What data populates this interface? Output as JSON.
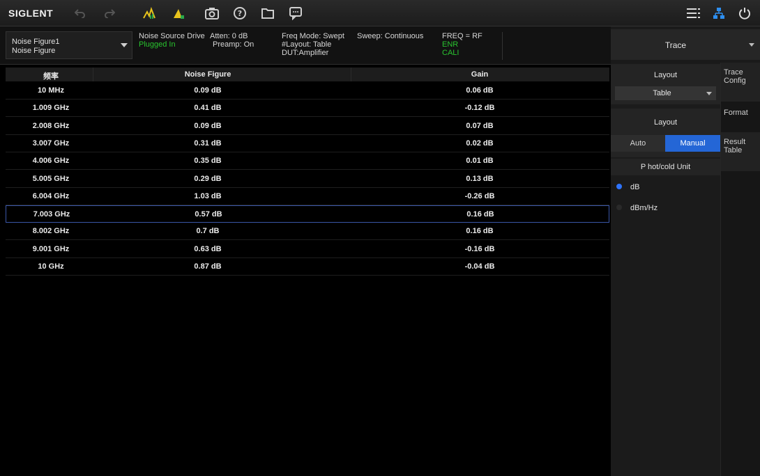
{
  "app": {
    "logo": "SIGLENT",
    "toolbar_icons": [
      "undo-icon",
      "redo-icon",
      "peak-search-icon",
      "marker-icon",
      "screenshot-icon",
      "help-icon",
      "file-icon",
      "message-icon"
    ],
    "right_icons": [
      "menu-list-icon",
      "network-icon",
      "power-icon"
    ]
  },
  "status": {
    "trace_name": "Noise Figure1",
    "trace_type": "Noise Figure",
    "noise_source_label": "Noise Source Drive",
    "noise_source_value": "Plugged In",
    "atten": "Atten: 0 dB",
    "preamp": "Preamp: On",
    "freq_mode": "Freq Mode: Swept",
    "layout": "#Layout: Table",
    "dut": "DUT:Amplifier",
    "sweep": "Sweep: Continuous",
    "freq": "FREQ = RF",
    "enr": "ENR",
    "cali": "CALI"
  },
  "table": {
    "headers": [
      "频率",
      "Noise Figure",
      "Gain"
    ],
    "rows": [
      {
        "freq": "10 MHz",
        "nf": "0.09 dB",
        "gain": "0.06 dB"
      },
      {
        "freq": "1.009 GHz",
        "nf": "0.41 dB",
        "gain": "-0.12 dB"
      },
      {
        "freq": "2.008 GHz",
        "nf": "0.09 dB",
        "gain": "0.07 dB"
      },
      {
        "freq": "3.007 GHz",
        "nf": "0.31 dB",
        "gain": "0.02 dB"
      },
      {
        "freq": "4.006 GHz",
        "nf": "0.35 dB",
        "gain": "0.01 dB"
      },
      {
        "freq": "5.005 GHz",
        "nf": "0.29 dB",
        "gain": "0.13 dB"
      },
      {
        "freq": "6.004 GHz",
        "nf": "1.03 dB",
        "gain": "-0.26 dB"
      },
      {
        "freq": "7.003 GHz",
        "nf": "0.57 dB",
        "gain": "0.16 dB"
      },
      {
        "freq": "8.002 GHz",
        "nf": "0.7 dB",
        "gain": "0.16 dB"
      },
      {
        "freq": "9.001 GHz",
        "nf": "0.63 dB",
        "gain": "-0.16 dB"
      },
      {
        "freq": "10 GHz",
        "nf": "0.87 dB",
        "gain": "-0.04 dB"
      }
    ],
    "selected_row": 7
  },
  "panel": {
    "title": "Trace",
    "layout_label": "Layout",
    "layout_value": "Table",
    "layout2_label": "Layout",
    "auto_label": "Auto",
    "manual_label": "Manual",
    "unit_label": "P hot/cold Unit",
    "unit_db": "dB",
    "unit_dbmhz": "dBm/Hz",
    "sub_tabs": [
      "Trace Config",
      "Format",
      "Result Table"
    ]
  },
  "colors": {
    "accent": "#2466d6",
    "status_green": "#29c42f",
    "radio_selected": "#2e74ff"
  }
}
